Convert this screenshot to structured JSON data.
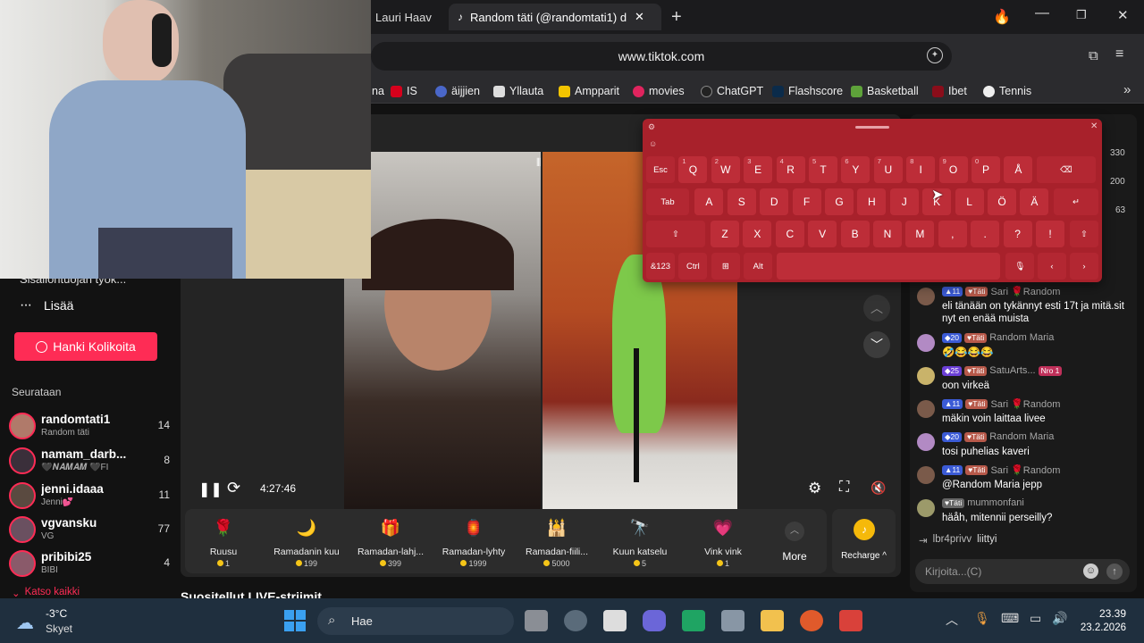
{
  "browser": {
    "tabs": [
      {
        "label": "Lauri Haav"
      },
      {
        "label": "Random täti (@randomtati1) d"
      }
    ],
    "url": "www.tiktok.com",
    "bookmarks": [
      "na",
      "IS",
      "äijjien",
      "Yllauta",
      "Ampparit",
      "movies",
      "ChatGPT",
      "Flashscore",
      "Basketball",
      "Ibet",
      "Tennis"
    ]
  },
  "sidebar": {
    "more_label": "Lisää",
    "creator_tools_label": "Sisällöntuojan työk...",
    "coins_button": "Hanki Kolikoita",
    "following_heading": "Seurataan",
    "following": [
      {
        "name": "randomtati1",
        "sub": "Random täti",
        "count": "14"
      },
      {
        "name": "namam_darb...",
        "sub": "🖤𝑵𝑨𝑴𝑨𝑴 🖤FI",
        "count": "8"
      },
      {
        "name": "jenni.idaaa",
        "sub": "Jenni💕",
        "count": "11"
      },
      {
        "name": "vgvansku",
        "sub": "VG",
        "count": "77"
      },
      {
        "name": "pribibi25",
        "sub": "BIBI",
        "count": "4"
      }
    ],
    "see_all": "Katso kaikki"
  },
  "video": {
    "time": "4:27:46",
    "recommended_heading": "Suositellut LIVE-striimit"
  },
  "gifts": [
    {
      "name": "Ruusu",
      "price": "1",
      "icon": "rose"
    },
    {
      "name": "Ramadanin kuu",
      "price": "199",
      "icon": "moon"
    },
    {
      "name": "Ramadan-lahj...",
      "price": "399",
      "icon": "gift-box"
    },
    {
      "name": "Ramadan-lyhty",
      "price": "1999",
      "icon": "lantern"
    },
    {
      "name": "Ramadan-fiili...",
      "price": "5000",
      "icon": "mosque"
    },
    {
      "name": "Kuun katselu",
      "price": "5",
      "icon": "telescope"
    },
    {
      "name": "Vink vink",
      "price": "1",
      "icon": "heart"
    }
  ],
  "gift_more_label": "More",
  "recharge_label": "Recharge ^",
  "chat": {
    "ranking_values": [
      "330",
      "200",
      "63"
    ],
    "messages": [
      {
        "level": "11",
        "tag": "Täti",
        "user": "Sari 🌹Random",
        "text": "eli tänään on tykännyt esti 17t ja mitä.sit nyt en enää muista",
        "avatar_color": "#7a5a4a"
      },
      {
        "level": "20",
        "tag": "Täti",
        "user": "Random Maria",
        "text": "🤣😂😂😂",
        "avatar_color": "#b28ac4"
      },
      {
        "level": "25",
        "tag": "Täti",
        "user": "SatuArts...",
        "extra": "Nro 1",
        "text": "oon virkeä",
        "avatar_color": "#c9b36a"
      },
      {
        "level": "11",
        "tag": "Täti",
        "user": "Sari 🌹Random",
        "text": "mäkin voin laittaa livee",
        "avatar_color": "#7a5a4a"
      },
      {
        "level": "20",
        "tag": "Täti",
        "user": "Random Maria",
        "text": "tosi puhelias kaveri",
        "avatar_color": "#b28ac4"
      },
      {
        "level": "11",
        "tag": "Täti",
        "user": "Sari 🌹Random",
        "text": "@Random Maria jepp",
        "avatar_color": "#7a5a4a"
      },
      {
        "level": "",
        "tag": "Täti",
        "user": "mummonfani",
        "text": "häåh, mitennii perseilly?",
        "avatar_color": "#9c9a6a"
      }
    ],
    "join_user": "lbr4privv",
    "join_text": "liittyi",
    "input_placeholder": "Kirjoita...(C)"
  },
  "keyboard": {
    "row1": [
      [
        "Esc",
        ""
      ],
      [
        "Q",
        "1"
      ],
      [
        "W",
        "2"
      ],
      [
        "E",
        "3"
      ],
      [
        "R",
        "4"
      ],
      [
        "T",
        "5"
      ],
      [
        "Y",
        "6"
      ],
      [
        "U",
        "7"
      ],
      [
        "I",
        "8"
      ],
      [
        "O",
        "9"
      ],
      [
        "P",
        "0"
      ],
      [
        "Å",
        ""
      ]
    ],
    "row2": [
      "Tab",
      "A",
      "S",
      "D",
      "F",
      "G",
      "H",
      "J",
      "K",
      "L",
      "Ö",
      "Ä"
    ],
    "row3": [
      "Z",
      "X",
      "C",
      "V",
      "B",
      "N",
      "M",
      ",",
      ".",
      "?",
      "!"
    ],
    "row4": [
      "&123",
      "Ctrl",
      "⊞",
      "Alt"
    ]
  },
  "taskbar": {
    "weather_temp": "-3°C",
    "weather_text": "Skyet",
    "search_label": "Hae",
    "time": "23.39",
    "date": "23.2.2026"
  }
}
